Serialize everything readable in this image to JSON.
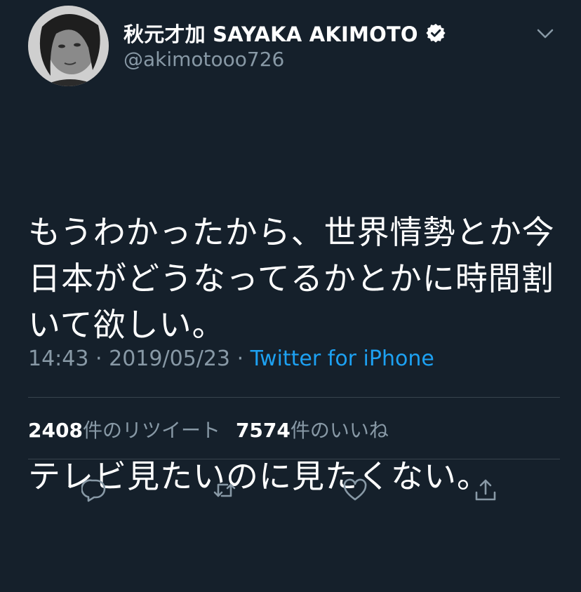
{
  "tweet": {
    "author": {
      "display_name": "秋元才加 SAYAKA AKIMOTO",
      "handle": "@akimotooo726",
      "verified": true
    },
    "paragraphs": [
      "もうわかったから、世界情勢とか今日本がどうなってるかとかに時間割いて欲しい。",
      "テレビ見たいのに見たくない。"
    ],
    "time": "14:43",
    "separator": "·",
    "date": "2019/05/23",
    "source": "Twitter for iPhone",
    "stats": {
      "retweets_count": "2408",
      "retweets_label": "件のリツイート",
      "likes_count": "7574",
      "likes_label": "件のいいね"
    }
  },
  "icons": {
    "more": "chevron-down-icon",
    "verified": "verified-badge-icon",
    "reply": "reply-icon",
    "retweet": "retweet-icon",
    "like": "heart-icon",
    "share": "share-icon"
  },
  "colors": {
    "background": "#15202b",
    "text": "#ffffff",
    "secondary": "#8899a6",
    "link": "#1da1f2",
    "divider": "#38444d"
  }
}
